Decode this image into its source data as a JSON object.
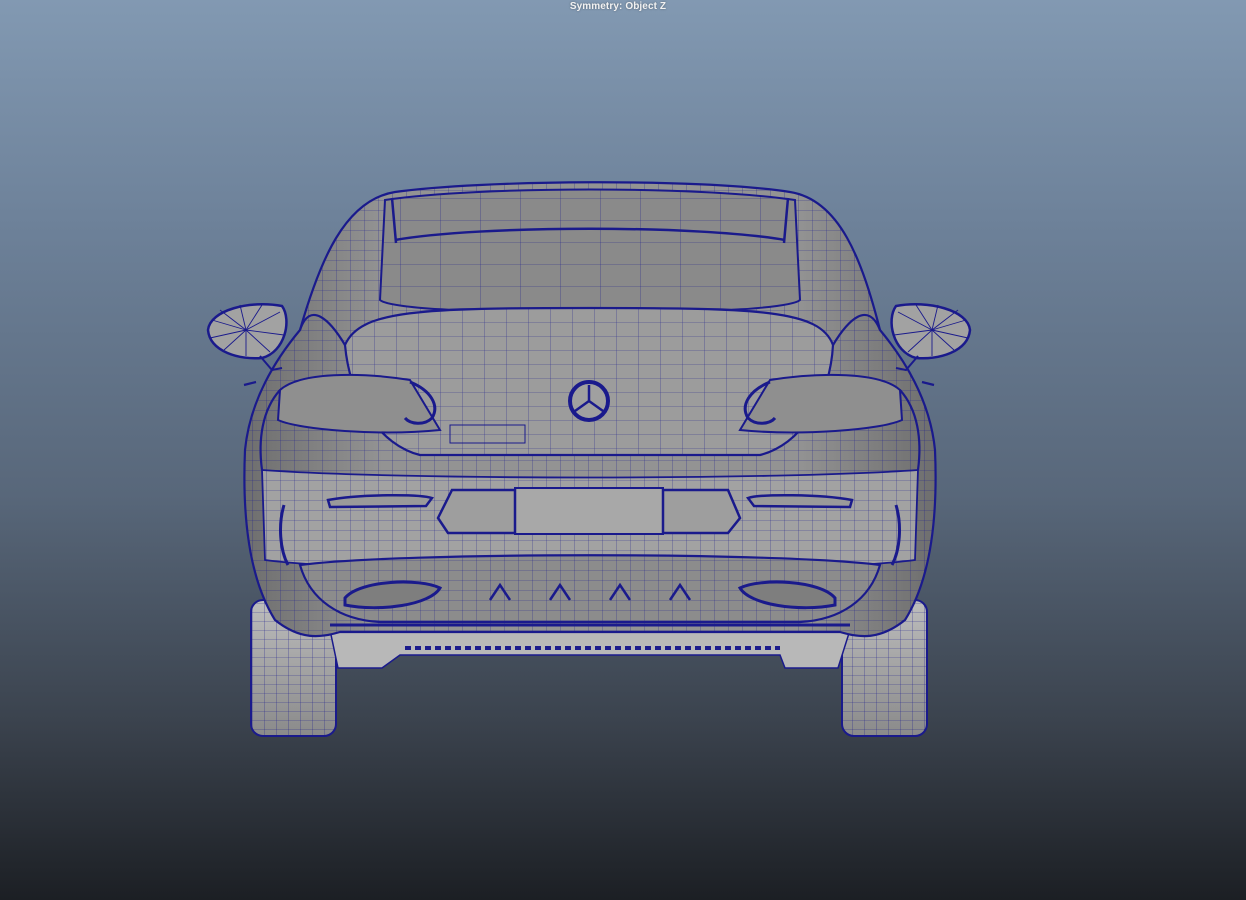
{
  "viewport": {
    "hud_text": "Symmetry: Object Z",
    "background_top": "#8299b2",
    "background_bottom": "#1c1f24",
    "wire_color": "#1a1a8c",
    "surface_color": "#8e8e8e"
  },
  "model": {
    "description_icon": "car-rear-wireframe"
  }
}
